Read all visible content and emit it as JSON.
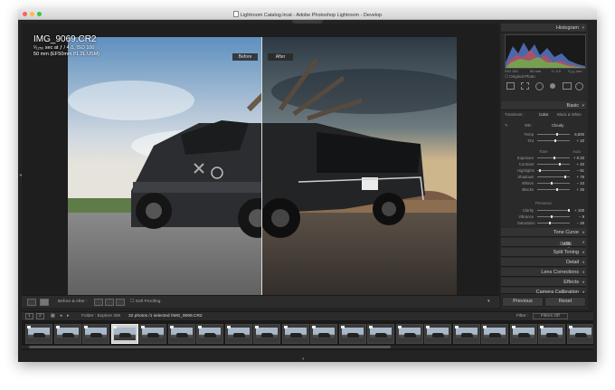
{
  "window": {
    "title": "Lightroom Catalog.lrcat - Adobe Photoshop Lightroom - Develop"
  },
  "photo": {
    "filename": "IMG_9069.CR2",
    "exposure_line": "¹⁄₁₂₅₀ sec at ƒ / 4.0, ISO 100",
    "lens_line": "50 mm (EF50mm f/1.2L USM)",
    "before_label": "Before",
    "after_label": "After"
  },
  "toolbar": {
    "view_mode": "Before & After :",
    "soft_proofing": "Soft Proofing"
  },
  "histogram": {
    "title": "Histogram",
    "readout": [
      "ISO 100",
      "50 mm",
      "f / 4.0",
      "¹⁄₁₂₅₀ sec"
    ],
    "original_photo": "Original Photo"
  },
  "basic": {
    "title": "Basic",
    "treatment_label": "Treatment :",
    "color": "Color",
    "bw": "Black & White",
    "wb_label": "WB :",
    "wb_value": "Cloudy",
    "tone_label": "Tone",
    "auto": "Auto",
    "presence_label": "Presence",
    "sliders": [
      {
        "label": "Temp",
        "value": "6,500",
        "pos": 0.62
      },
      {
        "label": "Tint",
        "value": "+ 10",
        "pos": 0.55
      },
      {
        "label": "Exposure",
        "value": "+ 0.33",
        "pos": 0.53
      },
      {
        "label": "Contrast",
        "value": "+ 40",
        "pos": 0.7
      },
      {
        "label": "Highlights",
        "value": "− 91",
        "pos": 0.05
      },
      {
        "label": "Shadows",
        "value": "+ 76",
        "pos": 0.88
      },
      {
        "label": "Whites",
        "value": "− 10",
        "pos": 0.45
      },
      {
        "label": "Blacks",
        "value": "+ 25",
        "pos": 0.62
      },
      {
        "label": "Clarity",
        "value": "+ 100",
        "pos": 1.0
      },
      {
        "label": "Vibrance",
        "value": "− 9",
        "pos": 0.45
      },
      {
        "label": "Saturation",
        "value": "− 26",
        "pos": 0.37
      }
    ]
  },
  "panels": {
    "tone_curve": "Tone Curve",
    "hsl": "HSL",
    "sep1": "/",
    "color": "Color",
    "sep2": "/",
    "bw": "B & W",
    "split_toning": "Split Toning",
    "detail": "Detail",
    "lens_corrections": "Lens Corrections",
    "effects": "Effects",
    "camera_calibration": "Camera Calibration"
  },
  "buttons": {
    "previous": "Previous",
    "reset": "Reset"
  },
  "filmstrip": {
    "page1": "1",
    "page2": "2",
    "source": "Folder : Explore 300",
    "count": "32 photos /1 selected /IMG_9069.CR2",
    "filter_label": "Filter :",
    "filter_value": "Filters Off"
  },
  "colors": {
    "panel_bg": "#2a2a2a",
    "window_bg": "#232323",
    "accent_text": "#cfcfcf"
  }
}
